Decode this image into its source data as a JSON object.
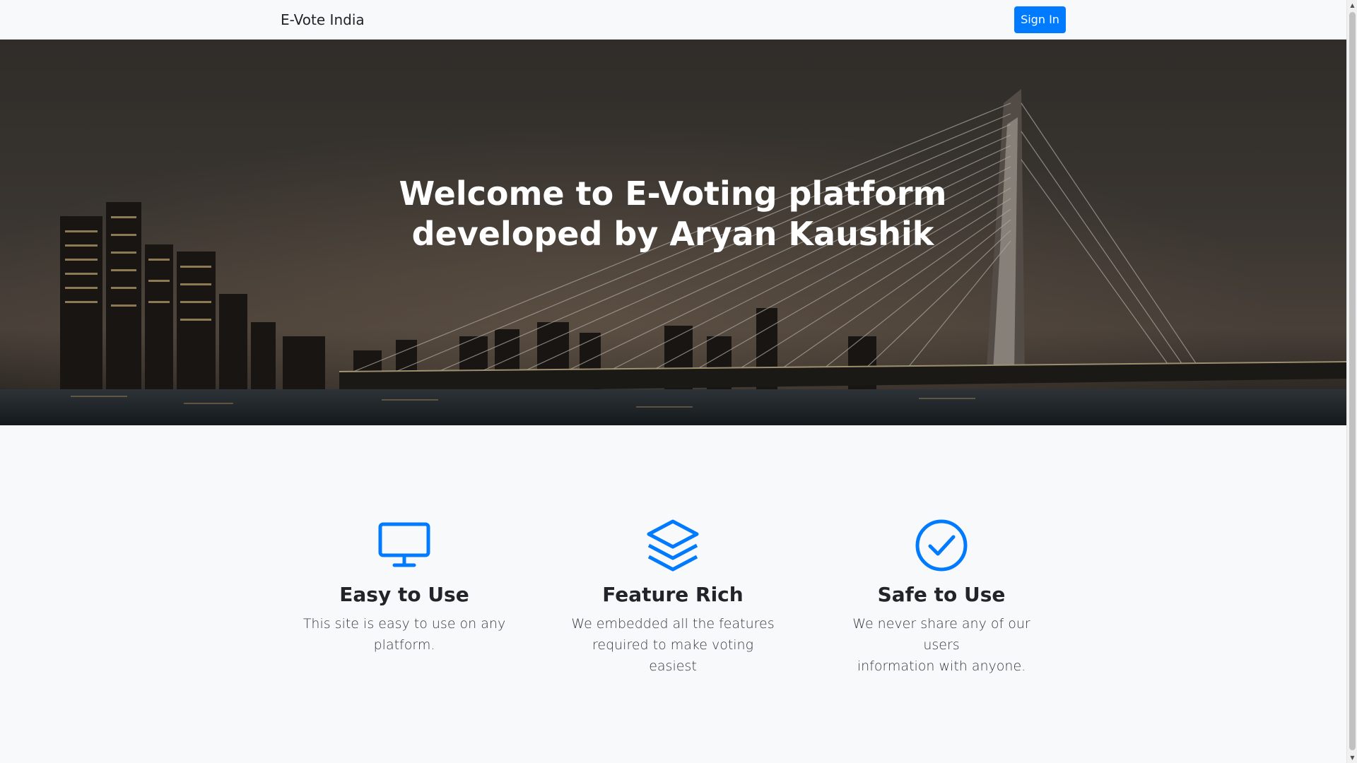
{
  "navbar": {
    "brand": "E-Vote India",
    "signin_label": "Sign In"
  },
  "hero": {
    "title_line1": "Welcome to E-Voting platform",
    "title_line2": "developed by Aryan Kaushik"
  },
  "features": [
    {
      "icon": "desktop-icon",
      "heading": "Easy to Use",
      "text_line1": "This site is easy to use on any",
      "text_line2": "platform."
    },
    {
      "icon": "layers-icon",
      "heading": "Feature Rich",
      "text_line1": "We embedded all the features",
      "text_line2": "required to make voting easiest"
    },
    {
      "icon": "check-circle-icon",
      "heading": "Safe to Use",
      "text_line1": "We never share any of our users",
      "text_line2": "information with anyone."
    }
  ],
  "colors": {
    "accent": "#007bff",
    "page_bg": "#f8f9fa",
    "text": "#212529"
  }
}
